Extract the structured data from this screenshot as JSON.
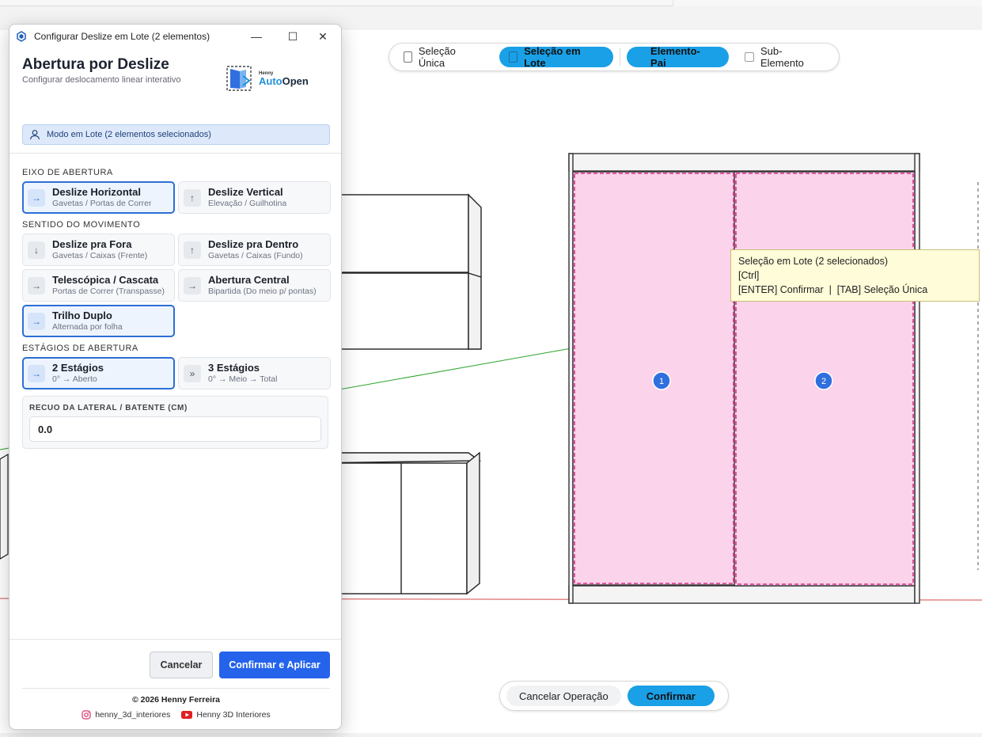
{
  "window": {
    "title": "Configurar Deslize em Lote (2 elementos)",
    "minimize_glyph": "—",
    "maximize_glyph": "☐",
    "close_glyph": "✕"
  },
  "header": {
    "title": "Abertura por Deslize",
    "subtitle": "Configurar deslocamento linear interativo",
    "logo_brand": "Henny",
    "logo_name_a": "Auto",
    "logo_name_b": "Open",
    "batch_banner": "Modo em Lote (2 elementos selecionados)"
  },
  "sections": {
    "eixo": {
      "label": "EIXO DE ABERTURA",
      "options": [
        {
          "name": "Deslize Horizontal",
          "sub": "Gavetas / Portas de Correr",
          "icon": "→",
          "icon_name": "arrow-right-icon",
          "selected": true
        },
        {
          "name": "Deslize Vertical",
          "sub": "Elevação / Guilhotina",
          "icon": "↑",
          "icon_name": "arrow-up-icon",
          "selected": false
        }
      ]
    },
    "sentido": {
      "label": "SENTIDO DO MOVIMENTO",
      "options": [
        {
          "name": "Deslize pra Fora",
          "sub": "Gavetas / Caixas (Frente)",
          "icon": "↓",
          "icon_name": "arrow-down-icon",
          "selected": false
        },
        {
          "name": "Deslize pra Dentro",
          "sub": "Gavetas / Caixas (Fundo)",
          "icon": "↑",
          "icon_name": "arrow-up-icon",
          "selected": false
        },
        {
          "name": "Telescópica / Cascata",
          "sub": "Portas de Correr (Transpasse)",
          "icon": "→",
          "icon_name": "arrow-right-icon",
          "selected": false
        },
        {
          "name": "Abertura Central",
          "sub": "Bipartida (Do meio p/ pontas)",
          "icon": "→",
          "icon_name": "arrow-right-icon",
          "selected": false
        },
        {
          "name": "Trilho Duplo",
          "sub": "Alternada por folha",
          "icon": "→",
          "icon_name": "arrow-right-icon",
          "selected": true
        }
      ]
    },
    "estagios": {
      "label": "ESTÁGIOS DE ABERTURA",
      "options": [
        {
          "name": "2 Estágios",
          "sub": "0° → Aberto",
          "icon": "→",
          "icon_name": "arrow-right-icon",
          "selected": true
        },
        {
          "name": "3 Estágios",
          "sub": "0° → Meio → Total",
          "icon": "»",
          "icon_name": "double-chevron-icon",
          "selected": false
        }
      ]
    },
    "recuo": {
      "label": "RECUO DA LATERAL / BATENTE (CM)",
      "value": "0.0"
    }
  },
  "footer": {
    "cancel_label": "Cancelar",
    "confirm_label": "Confirmar e Aplicar",
    "copyright": "© 2026 Henny Ferreira",
    "instagram": "henny_3d_interiores",
    "youtube": "Henny 3D Interiores"
  },
  "mode_toolbar": {
    "items": [
      {
        "label": "Seleção Única",
        "active": false,
        "kind": "doc"
      },
      {
        "label": "Seleção em Lote",
        "active": true,
        "kind": "doc"
      },
      {
        "label": "Elemento-Pai",
        "active": true,
        "kind": "none"
      },
      {
        "label": "Sub-Elemento",
        "active": false,
        "kind": "check"
      }
    ]
  },
  "tooltip": {
    "line1": "Seleção em Lote (2 selecionados)",
    "line2": "[Ctrl]",
    "line3": "[ENTER] Confirmar  |  [TAB] Seleção Única"
  },
  "markers": [
    "1",
    "2"
  ],
  "confirm_bar": {
    "cancel_label": "Cancelar Operação",
    "confirm_label": "Confirmar"
  },
  "colors": {
    "accent": "#2563eb",
    "toolbar_active": "#1aa0e6",
    "selection_fill": "#fbd3ea",
    "selection_stroke": "#d6338a",
    "marker": "#2f6fde"
  }
}
